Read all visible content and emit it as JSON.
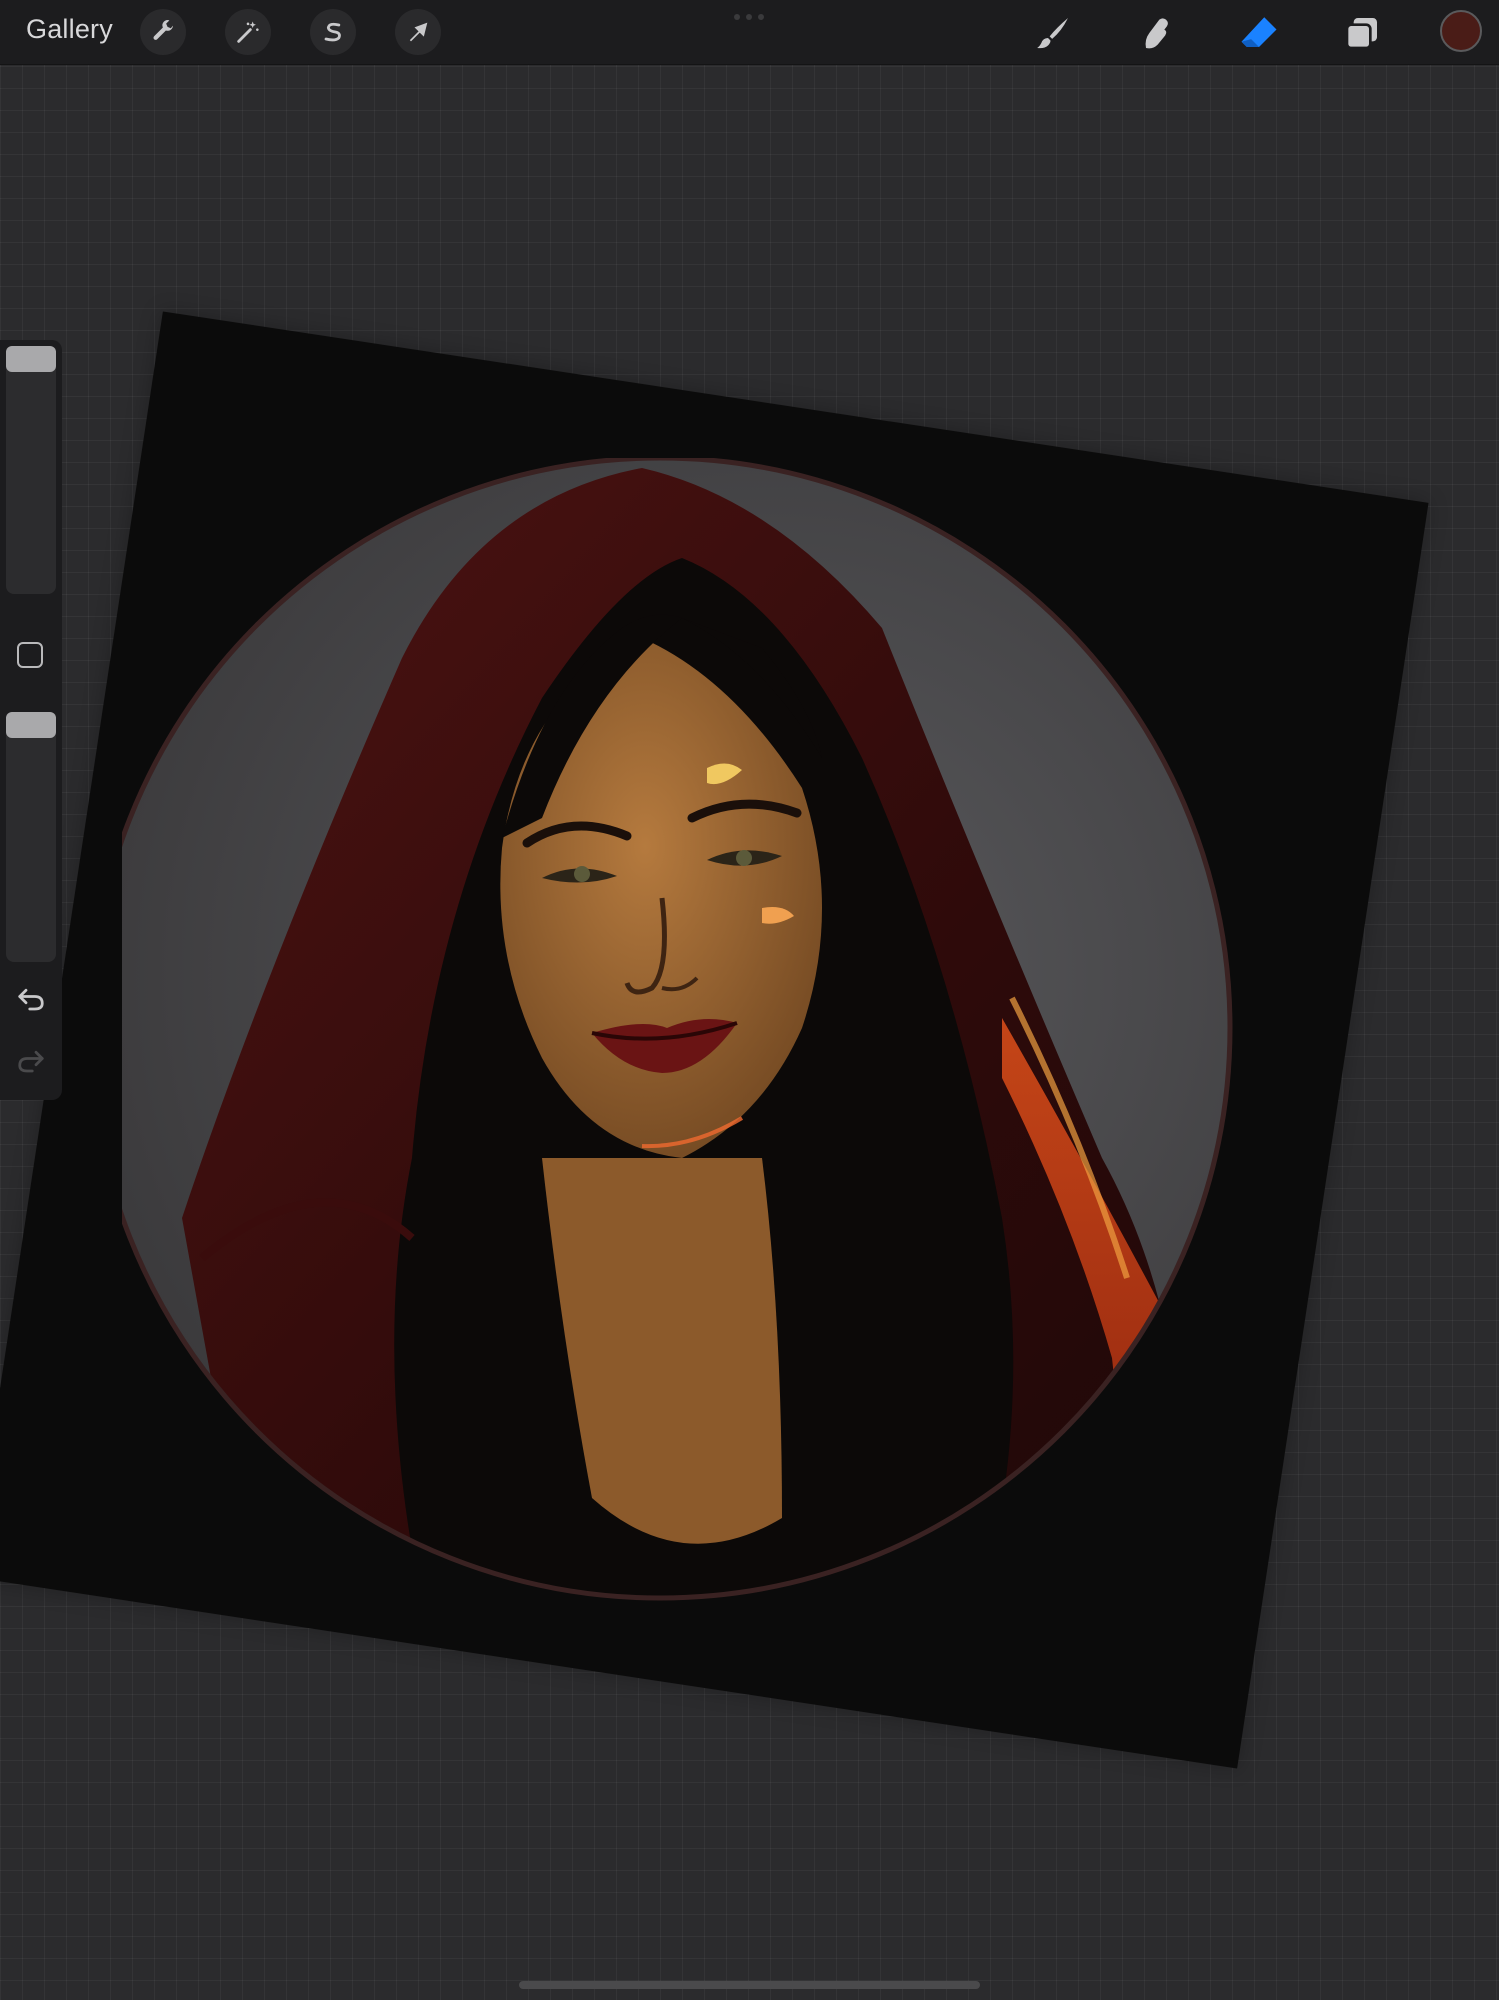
{
  "topbar": {
    "gallery_label": "Gallery",
    "left_tools": [
      {
        "name": "actions",
        "icon": "wrench-icon"
      },
      {
        "name": "adjustments",
        "icon": "magic-wand-icon"
      },
      {
        "name": "selection",
        "icon": "selection-s-icon"
      },
      {
        "name": "transform",
        "icon": "arrow-cursor-icon"
      }
    ],
    "right_tools": [
      {
        "name": "brush",
        "icon": "brush-icon"
      },
      {
        "name": "smudge",
        "icon": "smudge-finger-icon"
      },
      {
        "name": "eraser",
        "icon": "eraser-icon",
        "active": true
      },
      {
        "name": "layers",
        "icon": "layers-icon"
      }
    ],
    "current_color": "#4a1c17",
    "accent_color": "#1a82ff"
  },
  "sidebar": {
    "brush_size_slider": {
      "level": 1.0
    },
    "modify_button": {
      "icon": "square-icon"
    },
    "opacity_slider": {
      "level": 1.0
    },
    "undo": {
      "icon": "undo-icon"
    },
    "redo": {
      "icon": "redo-icon",
      "enabled": false
    }
  },
  "canvas": {
    "artwork": "portrait-hooded-woman",
    "rotation_deg": 8.6,
    "background_color": "#0b0b0b"
  }
}
